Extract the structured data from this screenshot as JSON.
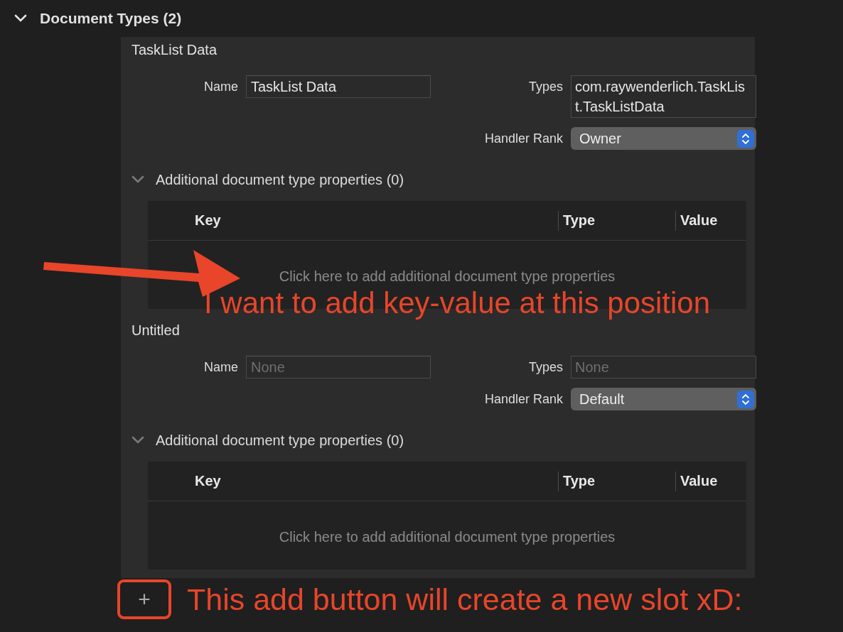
{
  "section": {
    "title": "Document Types (2)",
    "expanded": true
  },
  "document_types": [
    {
      "title": "TaskList Data",
      "labels": {
        "name": "Name",
        "types": "Types",
        "handler_rank": "Handler Rank"
      },
      "name": {
        "value": "TaskList Data"
      },
      "types": {
        "value": "com.raywenderlich.TaskList.TaskListData"
      },
      "handler_rank": "Owner",
      "properties_title": "Additional document type properties (0)",
      "properties_expanded": true,
      "columns": [
        "Key",
        "Type",
        "Value"
      ],
      "empty_hint": "Click here to add additional document type properties"
    },
    {
      "title": "Untitled",
      "labels": {
        "name": "Name",
        "types": "Types",
        "handler_rank": "Handler Rank"
      },
      "name": {
        "placeholder": "None"
      },
      "types": {
        "placeholder": "None"
      },
      "handler_rank": "Default",
      "properties_title": "Additional document type properties (0)",
      "properties_expanded": true,
      "columns": [
        "Key",
        "Type",
        "Value"
      ],
      "empty_hint": "Click here to add additional document type properties"
    }
  ],
  "add_button": "+",
  "annotations": [
    {
      "kind": "arrow-note",
      "text": "I want to add key-value at this position"
    },
    {
      "kind": "box-note",
      "text": "This add button will create a new slot xD:"
    }
  ]
}
